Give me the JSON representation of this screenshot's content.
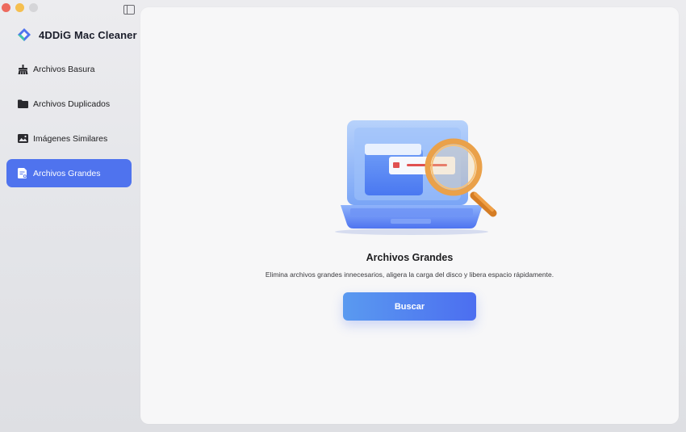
{
  "app": {
    "name": "4DDiG Mac Cleaner",
    "brand_color": "#4f73ee"
  },
  "sidebar": {
    "items": [
      {
        "label": "Archivos Basura",
        "icon": "broom-icon",
        "active": false
      },
      {
        "label": "Archivos Duplicados",
        "icon": "folder-icon",
        "active": false
      },
      {
        "label": "Imágenes Similares",
        "icon": "image-icon",
        "active": false
      },
      {
        "label": "Archivos Grandes",
        "icon": "large-file-icon",
        "active": true
      }
    ]
  },
  "main": {
    "title": "Archivos Grandes",
    "description": "Elimina archivos grandes innecesarios, aligera la carga del disco y libera espacio rápidamente.",
    "button_label": "Buscar",
    "illustration": "laptop-magnifier-illustration"
  }
}
